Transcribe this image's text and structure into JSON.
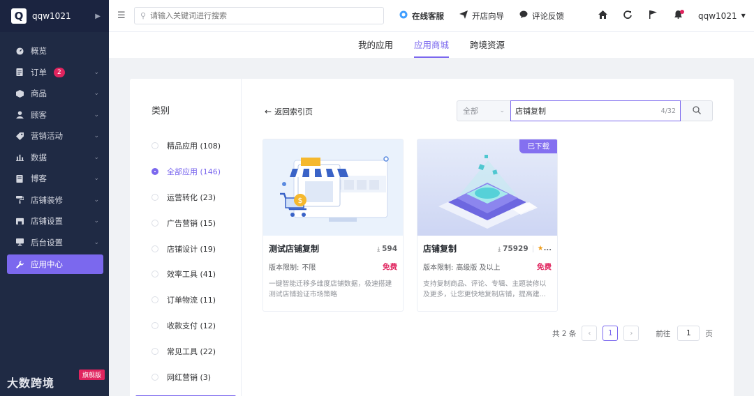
{
  "brand": {
    "logo_letter": "Q",
    "name": "qqw1021"
  },
  "sidebar": {
    "items": [
      {
        "label": "概览",
        "icon": "dashboard-icon",
        "has_chevron": false
      },
      {
        "label": "订单",
        "icon": "order-icon",
        "badge": "2",
        "has_chevron": true
      },
      {
        "label": "商品",
        "icon": "product-icon",
        "has_chevron": true
      },
      {
        "label": "顾客",
        "icon": "customer-icon",
        "has_chevron": true
      },
      {
        "label": "营销活动",
        "icon": "tag-icon",
        "has_chevron": true
      },
      {
        "label": "数据",
        "icon": "chart-icon",
        "has_chevron": true
      },
      {
        "label": "博客",
        "icon": "blog-icon",
        "has_chevron": true
      },
      {
        "label": "店铺装修",
        "icon": "paint-roller-icon",
        "has_chevron": true
      },
      {
        "label": "店铺设置",
        "icon": "store-settings-icon",
        "has_chevron": true
      },
      {
        "label": "后台设置",
        "icon": "monitor-icon",
        "has_chevron": true
      },
      {
        "label": "应用中心",
        "icon": "wrench-icon",
        "has_chevron": false,
        "active": true
      }
    ],
    "footer_logo": "大数跨境",
    "footer_tag": "旗舰版"
  },
  "header": {
    "search_placeholder": "请输入关键词进行搜索",
    "links": [
      {
        "label": "在线客服",
        "icon": "headset-icon",
        "primary": true
      },
      {
        "label": "开店向导",
        "icon": "paper-plane-icon",
        "primary": false
      },
      {
        "label": "评论反馈",
        "icon": "comment-icon",
        "primary": false
      }
    ],
    "user": "qqw1021"
  },
  "tabs": [
    {
      "label": "我的应用",
      "active": false
    },
    {
      "label": "应用商城",
      "active": true
    },
    {
      "label": "跨境资源",
      "active": false
    }
  ],
  "categories": {
    "title": "类别",
    "items": [
      {
        "label": "精品应用 (108)",
        "active": false
      },
      {
        "label": "全部应用 (146)",
        "active": true
      },
      {
        "label": "运营转化 (23)",
        "active": false
      },
      {
        "label": "广告营销 (15)",
        "active": false
      },
      {
        "label": "店铺设计 (19)",
        "active": false
      },
      {
        "label": "效率工具 (41)",
        "active": false
      },
      {
        "label": "订单物流 (11)",
        "active": false
      },
      {
        "label": "收款支付 (12)",
        "active": false
      },
      {
        "label": "常见工具 (22)",
        "active": false
      },
      {
        "label": "网红营销 (3)",
        "active": false
      }
    ]
  },
  "toolbar": {
    "back_label": "返回索引页",
    "filter_select": "全部",
    "search_value": "店铺复制",
    "search_count": "4/32"
  },
  "apps": [
    {
      "title": "测试店铺复制",
      "downloads": "594",
      "limit_label": "版本限制:",
      "limit_value": "不限",
      "price": "免费",
      "desc": "一键智能迁移多维度店铺数据，极速搭建测试店铺验证市场策略",
      "downloaded_tag": ""
    },
    {
      "title": "店铺复制",
      "downloads": "75929",
      "rating_more": "...",
      "limit_label": "版本限制:",
      "limit_value": "高级版 及以上",
      "price": "免费",
      "desc": "支持复制商品、评论、专辑、主题装修以及更多，让您更快地复制店铺，提高建...",
      "downloaded_tag": "已下载"
    }
  ],
  "pagination": {
    "total": "共 2 条",
    "current": "1",
    "goto_label": "前往",
    "goto_value": "1",
    "page_suffix": "页"
  },
  "colors": {
    "accent": "#7b68ee",
    "sidebar_bg": "#1f2a44",
    "badge": "#e0245e",
    "price": "#e0245e"
  }
}
